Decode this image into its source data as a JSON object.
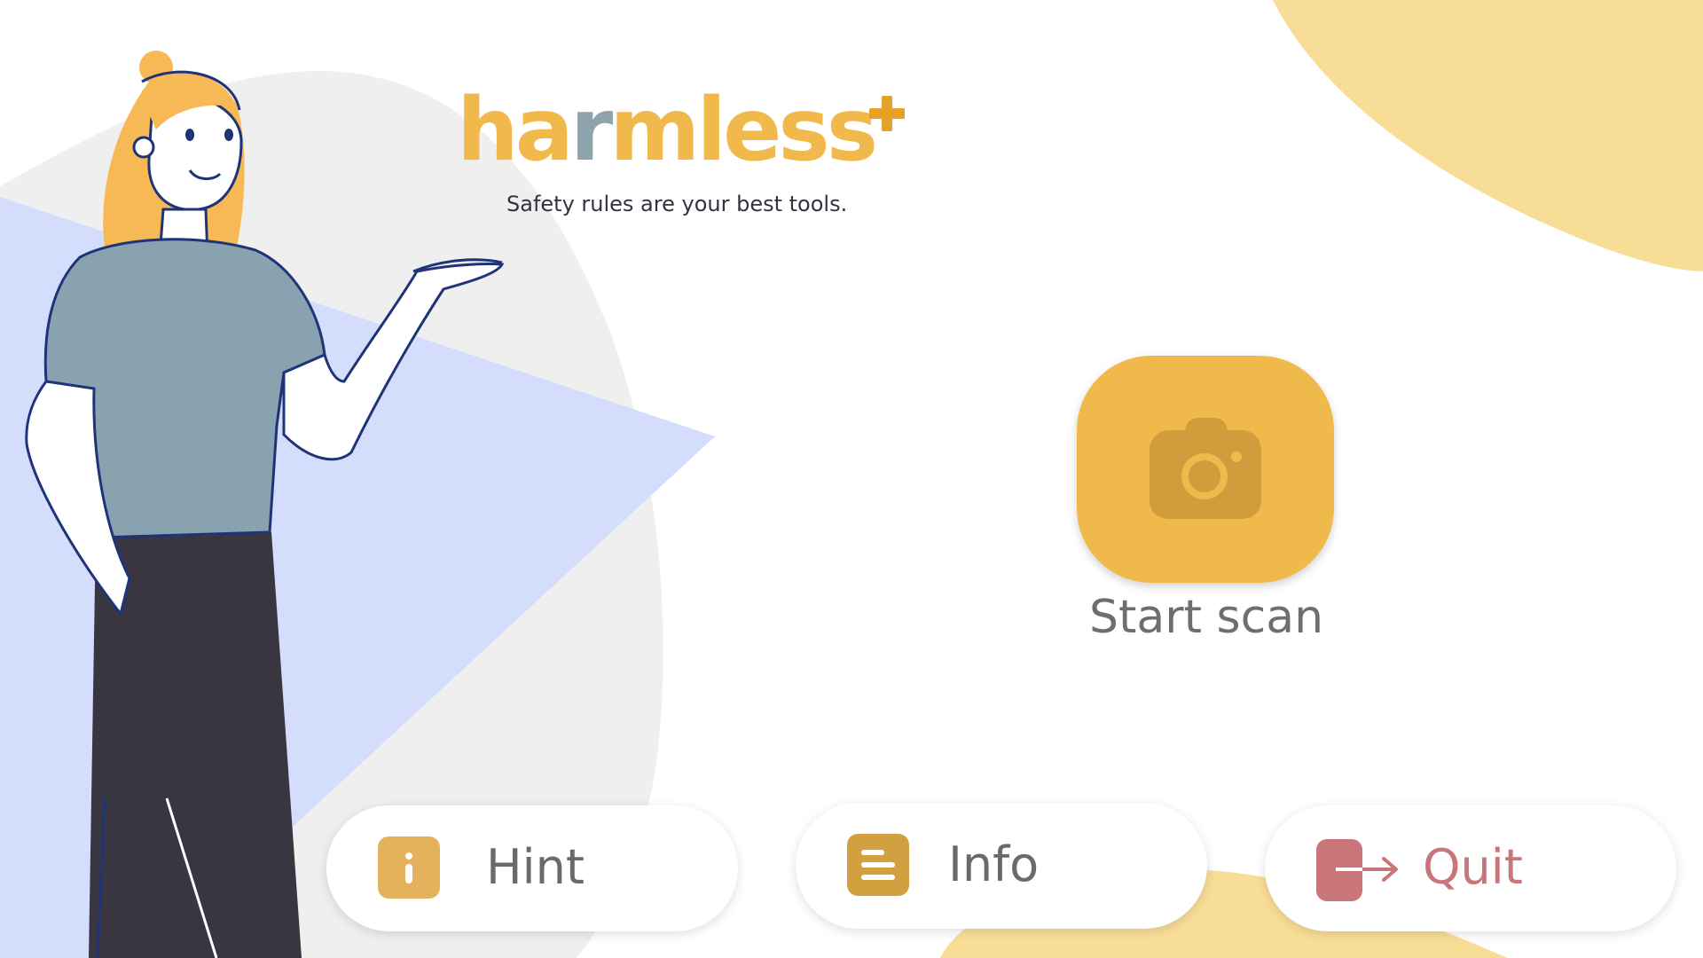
{
  "brand": {
    "name_parts": [
      {
        "text": "ha",
        "color": "#f1b94b"
      },
      {
        "text": "r",
        "color": "#8ea4ad"
      },
      {
        "text": "mless",
        "color": "#f1b94b"
      }
    ],
    "plus_color": "#e5a226",
    "tagline": "Safety rules are your best tools."
  },
  "scan": {
    "label": "Start scan",
    "icon": "camera-icon",
    "button_color": "#f0b94b",
    "icon_color": "#d19c3c"
  },
  "actions": [
    {
      "id": "hint",
      "label": "Hint",
      "icon": "info-icon",
      "icon_color": "#e3b25b",
      "label_color": "#6a6a6a"
    },
    {
      "id": "info",
      "label": "Info",
      "icon": "document-lines-icon",
      "icon_color": "#d2a13f",
      "label_color": "#6a6a6a"
    },
    {
      "id": "quit",
      "label": "Quit",
      "icon": "exit-door-icon",
      "icon_color": "#c9767a",
      "label_color": "#c9767a"
    }
  ],
  "background": {
    "blob_yellow": "#f8dd97",
    "blob_gray": "#efefef",
    "triangle_blue": "#d5ddfc"
  }
}
